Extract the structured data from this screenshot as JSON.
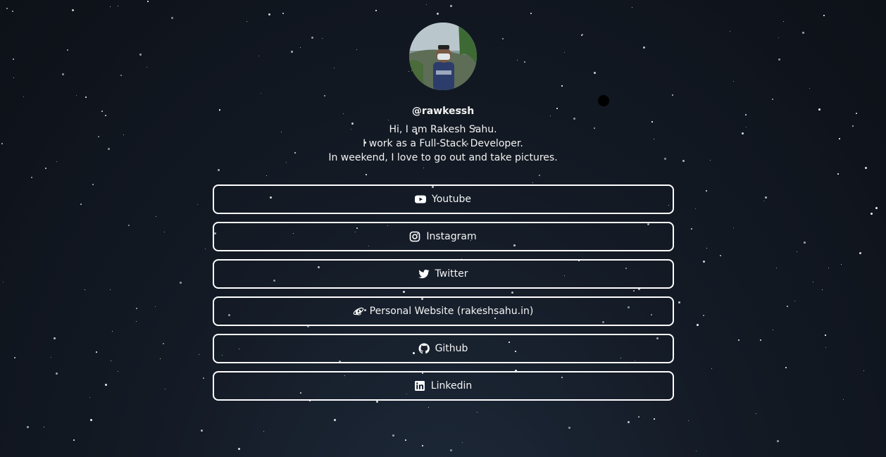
{
  "profile": {
    "handle": "@rawkessh",
    "bio": [
      "Hi, I am Rakesh Sahu.",
      "I work as a Full-Stack Developer.",
      "In weekend, I love to go out and take pictures."
    ]
  },
  "links": [
    {
      "label": "Youtube",
      "icon": "youtube-icon"
    },
    {
      "label": "Instagram",
      "icon": "instagram-icon"
    },
    {
      "label": "Twitter",
      "icon": "twitter-icon"
    },
    {
      "label": "Personal Website (rakeshsahu.in)",
      "icon": "internet-explorer-icon"
    },
    {
      "label": "Github",
      "icon": "github-icon"
    },
    {
      "label": "Linkedin",
      "icon": "linkedin-icon"
    }
  ],
  "colors": {
    "background": "#141b26",
    "text": "#f2f2f2",
    "border": "#ffffff"
  }
}
